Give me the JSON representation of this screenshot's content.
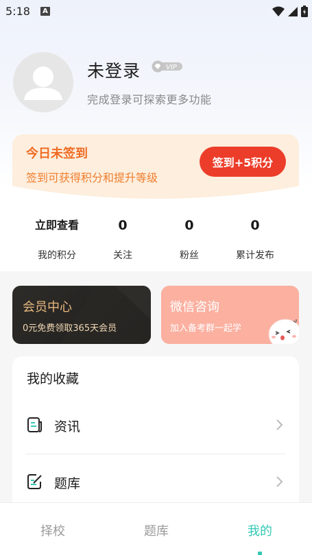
{
  "status_bar": {
    "time": "5:18",
    "notification_icon": "A",
    "icons": [
      "wifi-icon",
      "signal-icon",
      "battery-icon"
    ]
  },
  "profile": {
    "username": "未登录",
    "vip_badge": "VIP",
    "hint": "完成登录可探索更多功能"
  },
  "sign_in": {
    "title": "今日未签到",
    "subtitle": "签到可获得积分和提升等级",
    "button": "签到+5积分"
  },
  "stats": [
    {
      "value": "立即查看",
      "label": "我的积分"
    },
    {
      "value": "0",
      "label": "关注"
    },
    {
      "value": "0",
      "label": "粉丝"
    },
    {
      "value": "0",
      "label": "累计发布"
    }
  ],
  "promos": {
    "vip": {
      "title": "会员中心",
      "subtitle": "0元免费领取365天会员"
    },
    "wechat": {
      "title": "微信咨询",
      "subtitle": "加入备考群一起学"
    }
  },
  "favorites": {
    "title": "我的收藏",
    "items": [
      {
        "label": "资讯",
        "icon": "news-icon"
      },
      {
        "label": "题库",
        "icon": "question-bank-icon"
      }
    ]
  },
  "bottom_nav": {
    "items": [
      {
        "label": "择校",
        "active": false
      },
      {
        "label": "题库",
        "active": false
      },
      {
        "label": "我的",
        "active": true
      }
    ]
  },
  "colors": {
    "accent": "#34c8b4",
    "sign_button": "#ec3d2a",
    "sign_text": "#f06b23",
    "vip_gold": "#e9b97e",
    "wechat_bg": "#fbb0a0"
  }
}
